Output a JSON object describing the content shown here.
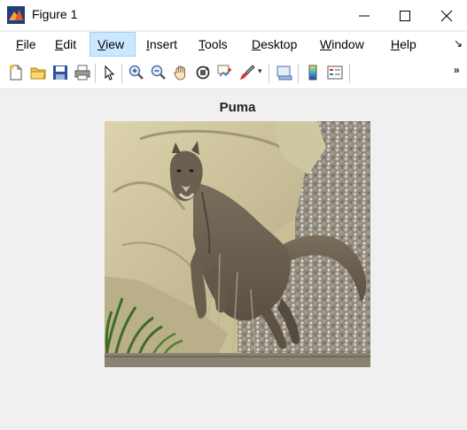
{
  "window": {
    "title": "Figure 1",
    "icon": "matlab-figure-icon"
  },
  "window_controls": [
    "minimize-icon",
    "maximize-icon",
    "close-icon"
  ],
  "menu": {
    "items": [
      {
        "label": "File",
        "underline": "F",
        "rest": "ile"
      },
      {
        "label": "Edit",
        "underline": "E",
        "rest": "dit"
      },
      {
        "label": "View",
        "underline": "V",
        "rest": "iew",
        "active": true
      },
      {
        "label": "Insert",
        "underline": "I",
        "rest": "nsert"
      },
      {
        "label": "Tools",
        "underline": "T",
        "rest": "ools"
      },
      {
        "label": "Desktop",
        "underline": "D",
        "rest": "esktop"
      },
      {
        "label": "Window",
        "underline": "W",
        "rest": "indow"
      },
      {
        "label": "Help",
        "underline": "H",
        "rest": "elp"
      }
    ],
    "overflow": "↘"
  },
  "toolbar": {
    "icons": [
      "new-figure-icon",
      "open-file-icon",
      "save-icon",
      "print-icon",
      "pointer-icon",
      "zoom-in-icon",
      "zoom-out-icon",
      "pan-icon",
      "rotate-3d-icon",
      "data-cursor-icon",
      "brush-icon",
      "colorbar-icon",
      "legend-icon"
    ],
    "overflow": "»"
  },
  "axes": {
    "title": "Puma",
    "image": "photo of a puma leaping between rocks"
  },
  "colors": {
    "background": "#f0f0f0",
    "menu_active": "#cce8ff"
  }
}
